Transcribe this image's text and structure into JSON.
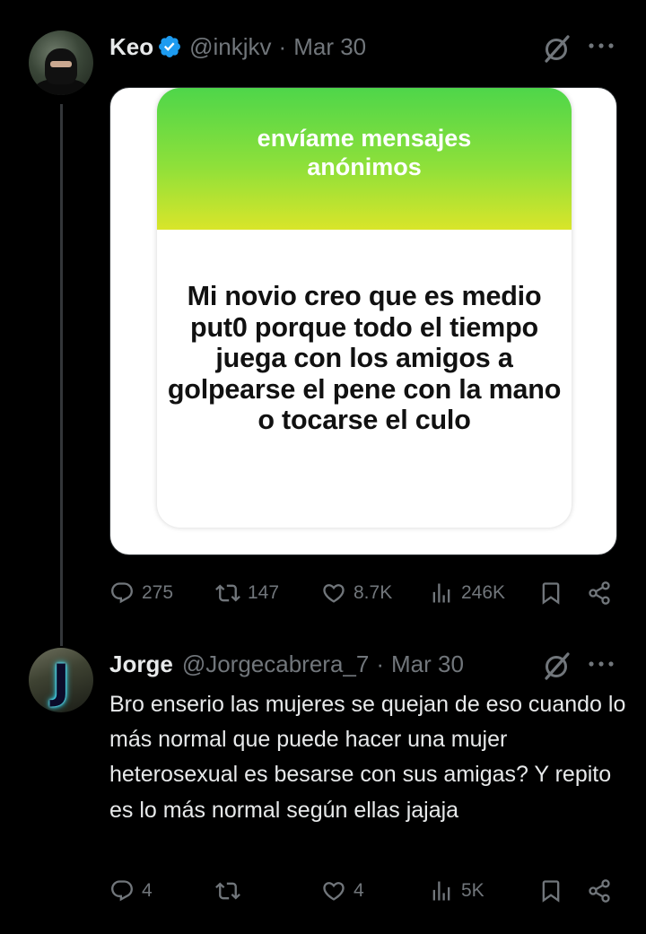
{
  "tweet": {
    "author_name": "Keo",
    "handle": "@inkjkv",
    "separator": "·",
    "date": "Mar 30",
    "media": {
      "card_title": "envíame mensajes anónimos",
      "message": "Mi novio creo que es medio put0 porque todo el tiempo juega con los amigos a golpearse el pene con la mano o tocarse el culo"
    },
    "stats": {
      "replies": "275",
      "reposts": "147",
      "likes": "8.7K",
      "views": "246K"
    }
  },
  "reply": {
    "author_name": "Jorge",
    "handle": "@Jorgecabrera_7",
    "separator": "·",
    "date": "Mar 30",
    "text": "Bro enserio las mujeres se quejan de eso cuando lo más normal que puede hacer una mujer heterosexual es besarse con sus amigas? Y repito es lo más normal según ellas jajaja",
    "stats": {
      "replies": "4",
      "reposts": "",
      "likes": "4",
      "views": "5K"
    }
  },
  "colors": {
    "background": "#000000",
    "text_primary": "#e7e9ea",
    "text_secondary": "#71767b",
    "verified_blue": "#1d9bf0",
    "thread_line": "#333639",
    "card_gradient_top": "#4ed64a",
    "card_gradient_bottom": "#d9e52a"
  },
  "icons": {
    "verified": "verified-badge-icon",
    "grok": "grok-icon",
    "more": "more-icon",
    "reply": "reply-icon",
    "repost": "repost-icon",
    "like": "like-icon",
    "views": "views-icon",
    "bookmark": "bookmark-icon",
    "share": "share-icon"
  }
}
